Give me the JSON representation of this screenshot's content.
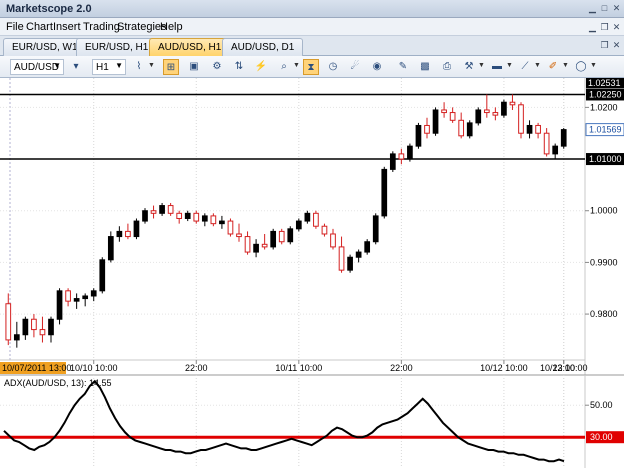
{
  "window": {
    "title": "Marketscope 2.0"
  },
  "menu": [
    "File",
    "Chart",
    "Insert",
    "Trading",
    "Strategies",
    "Help"
  ],
  "tabs": [
    {
      "label": "EUR/USD, W1",
      "active": false
    },
    {
      "label": "EUR/USD, H1",
      "active": false
    },
    {
      "label": "AUD/USD, H1",
      "active": true
    },
    {
      "label": "AUD/USD, D1",
      "active": false
    }
  ],
  "toolbar": {
    "instrument": "AUD/USD",
    "timeframe": "H1"
  },
  "price_chart": {
    "y_ticks": [
      "1.0200",
      "1.0000",
      "0.9900",
      "0.9800"
    ],
    "top_label": "1.02531",
    "current_price": "1.01569",
    "hlines": [
      {
        "value": 1.0225,
        "label": "1.02250"
      },
      {
        "value": 1.01,
        "label": "1.01000"
      }
    ],
    "x_ticks": [
      "10/10 10:00",
      "22:00",
      "10/11 10:00",
      "22:00",
      "10/12 10:00",
      "22:00",
      "10/13 10:00"
    ],
    "start_date": "10/07/2011 13:00"
  },
  "indicator": {
    "label": "ADX(AUD/USD, 13): 14.55",
    "y_ticks": [
      "50.00"
    ],
    "level_label": "30.00",
    "level_value": 30
  },
  "colors": {
    "bull": "#000000",
    "bear": "#d42020",
    "level": "#e00000",
    "date_badge": "#f0a020"
  },
  "chart_data": [
    {
      "type": "candlestick",
      "title": "AUD/USD, H1",
      "ylim": [
        0.9715,
        1.0253
      ],
      "hlines": [
        1.0225,
        1.01
      ],
      "candles": [
        [
          0.982,
          0.984,
          0.974,
          0.975
        ],
        [
          0.975,
          0.9785,
          0.9735,
          0.976
        ],
        [
          0.976,
          0.9795,
          0.975,
          0.979
        ],
        [
          0.979,
          0.98,
          0.9755,
          0.977
        ],
        [
          0.977,
          0.9795,
          0.9745,
          0.976
        ],
        [
          0.976,
          0.9795,
          0.9745,
          0.979
        ],
        [
          0.979,
          0.985,
          0.978,
          0.9845
        ],
        [
          0.9845,
          0.985,
          0.9815,
          0.9825
        ],
        [
          0.9825,
          0.984,
          0.981,
          0.983
        ],
        [
          0.983,
          0.984,
          0.9815,
          0.9835
        ],
        [
          0.9835,
          0.985,
          0.9825,
          0.9845
        ],
        [
          0.9845,
          0.991,
          0.984,
          0.9905
        ],
        [
          0.9905,
          0.996,
          0.99,
          0.995
        ],
        [
          0.995,
          0.997,
          0.994,
          0.996
        ],
        [
          0.996,
          0.9975,
          0.9945,
          0.995
        ],
        [
          0.995,
          0.9985,
          0.9945,
          0.998
        ],
        [
          0.998,
          1.0005,
          0.9975,
          1.0
        ],
        [
          1.0,
          1.001,
          0.9985,
          0.9995
        ],
        [
          0.9995,
          1.0015,
          0.999,
          1.001
        ],
        [
          1.001,
          1.0015,
          0.999,
          0.9995
        ],
        [
          0.9995,
          1.0,
          0.9975,
          0.9985
        ],
        [
          0.9985,
          1.0,
          0.998,
          0.9995
        ],
        [
          0.9995,
          1.0,
          0.9975,
          0.998
        ],
        [
          0.998,
          0.9995,
          0.997,
          0.999
        ],
        [
          0.999,
          0.9995,
          0.997,
          0.9975
        ],
        [
          0.9975,
          0.999,
          0.9965,
          0.998
        ],
        [
          0.998,
          0.9985,
          0.995,
          0.9955
        ],
        [
          0.9955,
          0.9975,
          0.994,
          0.995
        ],
        [
          0.995,
          0.996,
          0.9915,
          0.992
        ],
        [
          0.992,
          0.9945,
          0.991,
          0.9935
        ],
        [
          0.9935,
          0.9955,
          0.9925,
          0.993
        ],
        [
          0.993,
          0.9965,
          0.9925,
          0.996
        ],
        [
          0.996,
          0.9965,
          0.9935,
          0.994
        ],
        [
          0.994,
          0.997,
          0.9935,
          0.9965
        ],
        [
          0.9965,
          0.9985,
          0.996,
          0.998
        ],
        [
          0.998,
          1.0,
          0.9975,
          0.9995
        ],
        [
          0.9995,
          1.0,
          0.9965,
          0.997
        ],
        [
          0.997,
          0.9975,
          0.995,
          0.9955
        ],
        [
          0.9955,
          0.9965,
          0.9925,
          0.993
        ],
        [
          0.993,
          0.995,
          0.988,
          0.9885
        ],
        [
          0.9885,
          0.9915,
          0.988,
          0.991
        ],
        [
          0.991,
          0.9925,
          0.99,
          0.992
        ],
        [
          0.992,
          0.9945,
          0.9915,
          0.994
        ],
        [
          0.994,
          0.9995,
          0.9935,
          0.999
        ],
        [
          0.999,
          1.0085,
          0.9985,
          1.008
        ],
        [
          1.008,
          1.0115,
          1.0075,
          1.011
        ],
        [
          1.011,
          1.012,
          1.009,
          1.01
        ],
        [
          1.01,
          1.013,
          1.0095,
          1.0125
        ],
        [
          1.0125,
          1.017,
          1.012,
          1.0165
        ],
        [
          1.0165,
          1.018,
          1.014,
          1.015
        ],
        [
          1.015,
          1.02,
          1.0145,
          1.0195
        ],
        [
          1.0195,
          1.021,
          1.018,
          1.019
        ],
        [
          1.019,
          1.02,
          1.017,
          1.0175
        ],
        [
          1.0175,
          1.019,
          1.014,
          1.0145
        ],
        [
          1.0145,
          1.0175,
          1.014,
          1.017
        ],
        [
          1.017,
          1.02,
          1.0165,
          1.0195
        ],
        [
          1.0195,
          1.0225,
          1.018,
          1.019
        ],
        [
          1.019,
          1.02,
          1.0175,
          1.0185
        ],
        [
          1.0185,
          1.0215,
          1.018,
          1.021
        ],
        [
          1.021,
          1.0225,
          1.0195,
          1.0205
        ],
        [
          1.0205,
          1.021,
          1.014,
          1.015
        ],
        [
          1.015,
          1.0175,
          1.014,
          1.0165
        ],
        [
          1.0165,
          1.017,
          1.014,
          1.015
        ],
        [
          1.015,
          1.016,
          1.0105,
          1.011
        ],
        [
          1.011,
          1.013,
          1.01,
          1.0125
        ],
        [
          1.0125,
          1.016,
          1.012,
          1.0157
        ]
      ]
    },
    {
      "type": "line",
      "title": "ADX(AUD/USD, 13): 14.55",
      "ylim": [
        12,
        67
      ],
      "level": 30,
      "values": [
        34,
        31,
        28,
        27,
        25,
        23,
        22,
        24,
        25,
        27,
        30,
        34,
        39,
        45,
        50,
        54,
        57,
        62,
        65,
        61,
        55,
        48,
        42,
        37,
        33,
        30,
        28,
        27,
        26,
        25,
        24,
        23,
        22,
        22,
        21,
        21,
        20,
        20,
        21,
        22,
        22,
        23,
        24,
        25,
        26,
        25,
        24,
        23,
        23,
        22,
        22,
        23,
        24,
        25,
        26,
        27,
        28,
        29,
        28,
        27,
        26,
        25,
        27,
        29,
        31,
        34,
        36,
        35,
        33,
        31,
        30,
        30,
        31,
        33,
        36,
        38,
        39,
        40,
        41,
        43,
        45,
        48,
        51,
        54,
        51,
        47,
        43,
        39,
        36,
        33,
        30,
        28,
        26,
        25,
        24,
        23,
        22,
        22,
        21,
        21,
        20,
        20,
        19,
        19,
        18,
        17,
        16,
        16,
        15,
        15,
        16,
        15
      ]
    }
  ]
}
